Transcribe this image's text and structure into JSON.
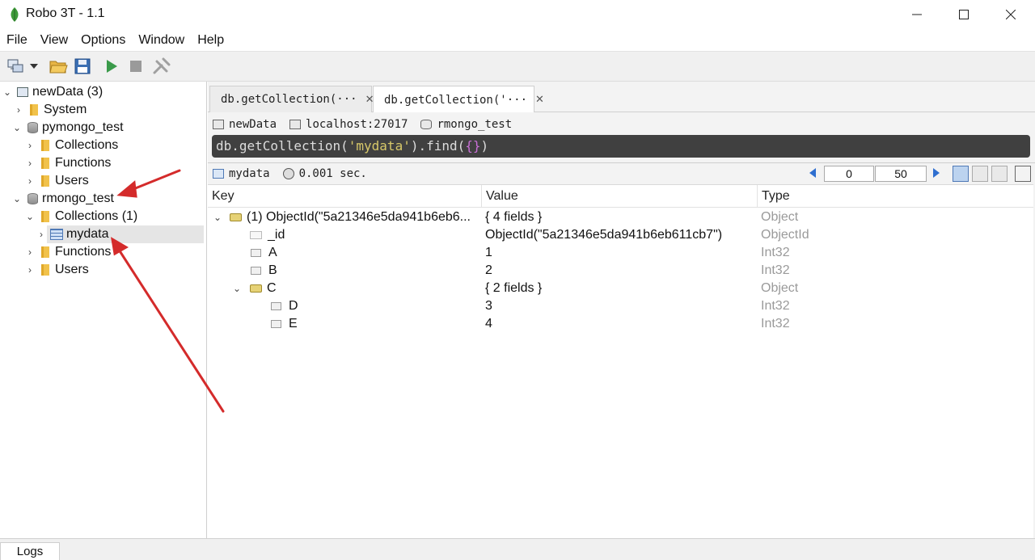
{
  "window": {
    "title": "Robo 3T - 1.1"
  },
  "menu": [
    "File",
    "View",
    "Options",
    "Window",
    "Help"
  ],
  "toolbar": {
    "icons": [
      "connect-icon",
      "dropdown-arrow-icon",
      "open-folder-icon",
      "save-icon",
      "run-icon",
      "stop-icon",
      "wrench-icon"
    ]
  },
  "tree": {
    "connection": "newData (3)",
    "system": "System",
    "db1": "pymongo_test",
    "db1_collections": "Collections",
    "db1_functions": "Functions",
    "db1_users": "Users",
    "db2": "rmongo_test",
    "db2_collections": "Collections (1)",
    "db2_collection_item": "mydata",
    "db2_functions": "Functions",
    "db2_users": "Users"
  },
  "tabs": [
    {
      "label": "db.getCollection(···"
    },
    {
      "label": "db.getCollection('···"
    }
  ],
  "query_meta": {
    "connection": "newData",
    "host": "localhost:27017",
    "database": "rmongo_test"
  },
  "query": {
    "prefix": "db.getCollection(",
    "arg": "'mydata'",
    "middle": ").find(",
    "braces": "{}",
    "suffix": ")"
  },
  "result_bar": {
    "collection": "mydata",
    "time": "0.001 sec.",
    "page_start": "0",
    "page_size": "50"
  },
  "grid": {
    "headers": {
      "key": "Key",
      "value": "Value",
      "type": "Type"
    },
    "rows": [
      {
        "key": "(1) ObjectId(\"5a21346e5da941b6eb6...",
        "value": "{ 4 fields }",
        "type": "Object"
      },
      {
        "key": "_id",
        "value": "ObjectId(\"5a21346e5da941b6eb611cb7\")",
        "type": "ObjectId"
      },
      {
        "key": "A",
        "value": "1",
        "type": "Int32"
      },
      {
        "key": "B",
        "value": "2",
        "type": "Int32"
      },
      {
        "key": "C",
        "value": "{ 2 fields }",
        "type": "Object"
      },
      {
        "key": "D",
        "value": "3",
        "type": "Int32"
      },
      {
        "key": "E",
        "value": "4",
        "type": "Int32"
      }
    ]
  },
  "bottom": {
    "logs_tab": "Logs"
  },
  "colors": {
    "accent": "#2f6fd0",
    "query_bg": "#404040",
    "string": "#d7c869",
    "arrow": "#d42b2b"
  }
}
